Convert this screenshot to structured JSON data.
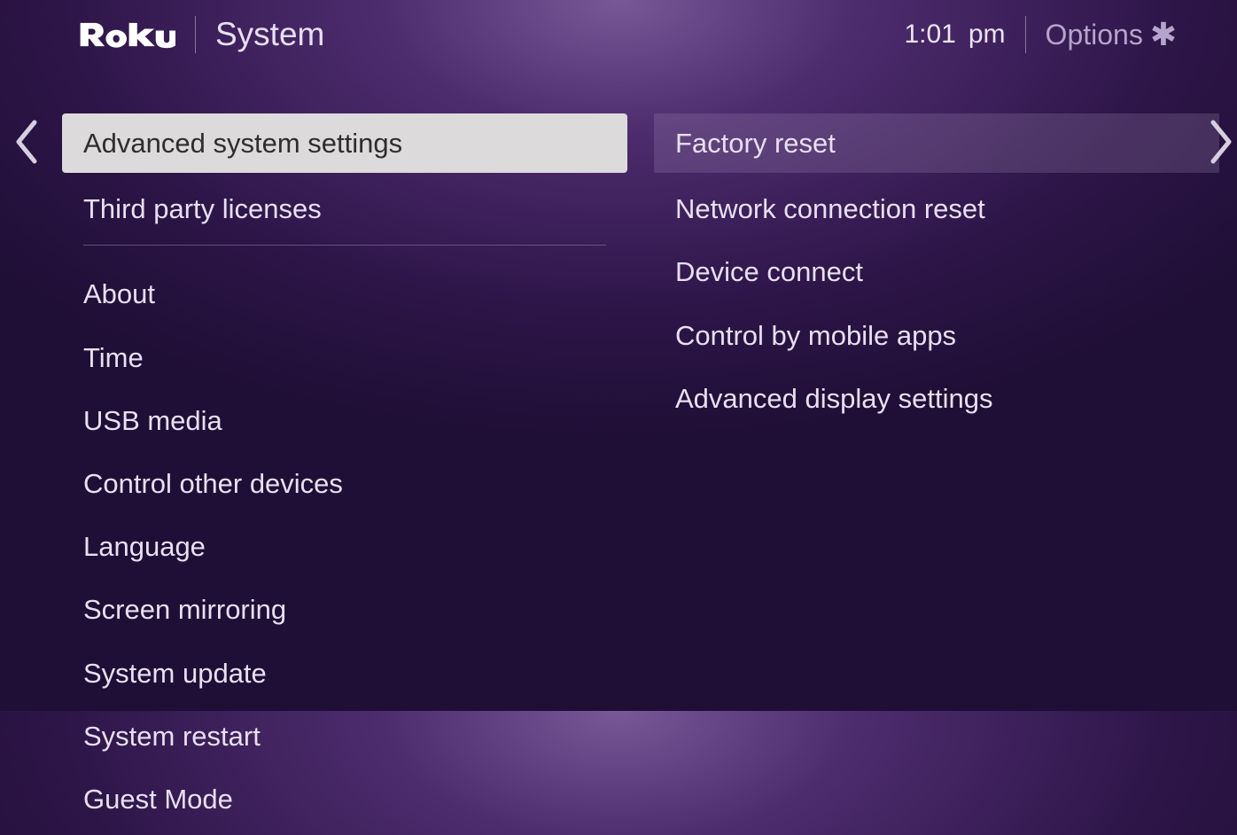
{
  "header": {
    "logo_text": "Roku",
    "page_title": "System",
    "time": "1:01",
    "period": "pm",
    "options_label": "Options"
  },
  "left_menu": {
    "items": [
      {
        "label": "Advanced system settings",
        "selected": true
      },
      {
        "label": "Third party licenses",
        "selected": false
      }
    ],
    "secondary_items": [
      {
        "label": "About"
      },
      {
        "label": "Time"
      },
      {
        "label": "USB media"
      },
      {
        "label": "Control other devices"
      },
      {
        "label": "Language"
      },
      {
        "label": "Screen mirroring"
      },
      {
        "label": "System update"
      },
      {
        "label": "System restart"
      },
      {
        "label": "Guest Mode"
      }
    ]
  },
  "right_menu": {
    "items": [
      {
        "label": "Factory reset",
        "highlighted": true
      },
      {
        "label": "Network connection reset",
        "highlighted": false
      },
      {
        "label": "Device connect",
        "highlighted": false
      },
      {
        "label": "Control by mobile apps",
        "highlighted": false
      },
      {
        "label": "Advanced display settings",
        "highlighted": false
      }
    ]
  }
}
